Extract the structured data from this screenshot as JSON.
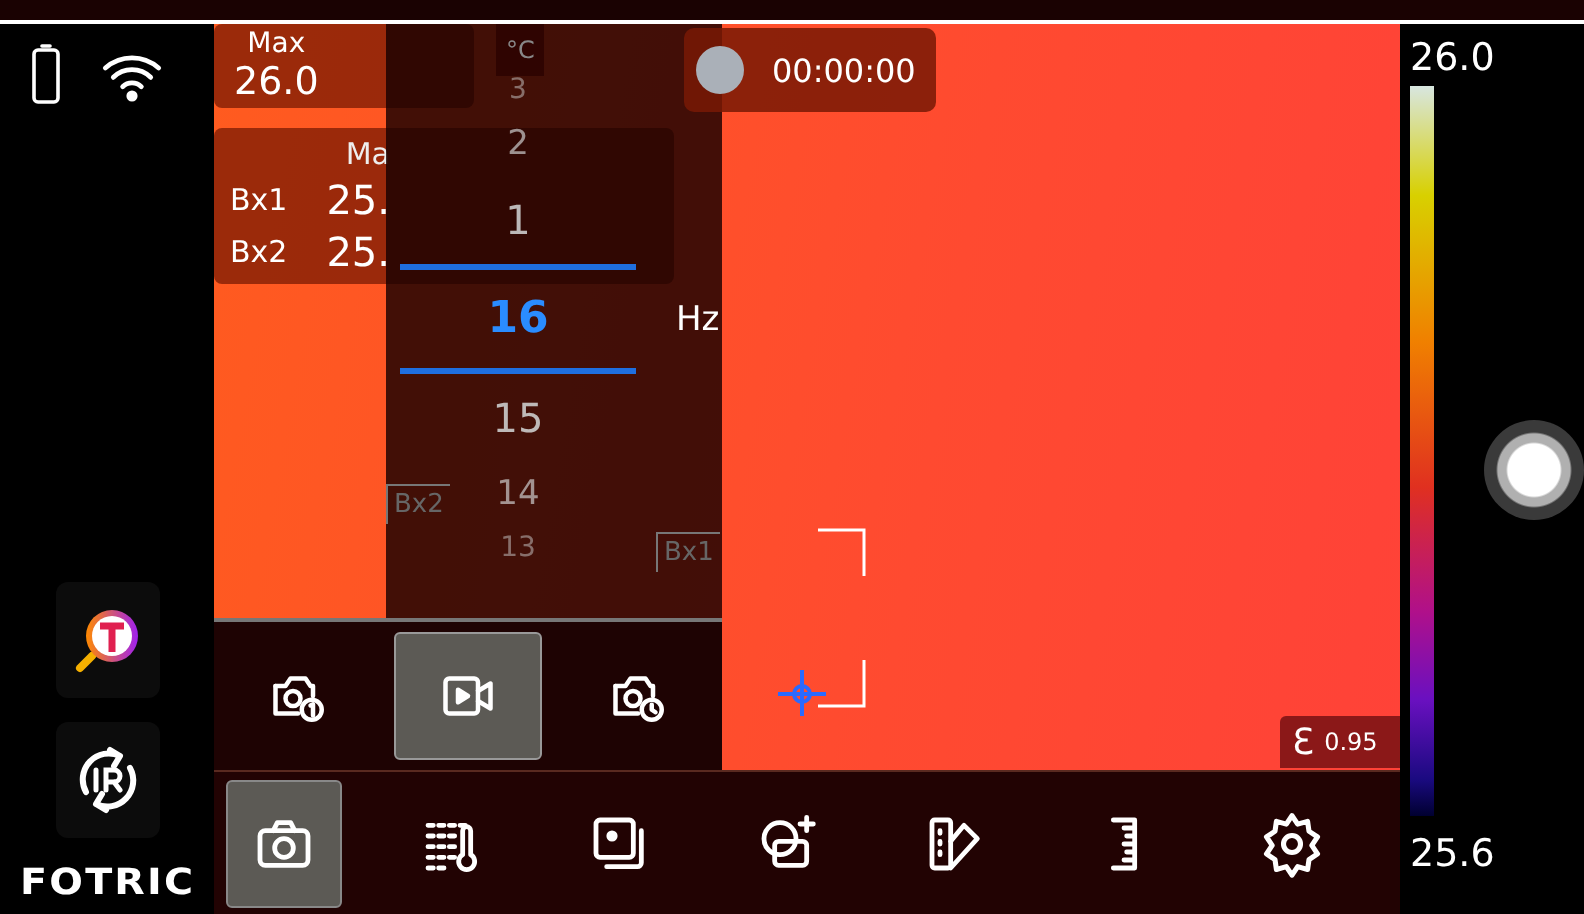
{
  "logo": "FOTRIC",
  "spot": {
    "label": "Max",
    "value": "26.0"
  },
  "temperature_unit": "°C",
  "box_table": {
    "columns": [
      "Ma"
    ],
    "rows": [
      {
        "name": "Bx1",
        "values": [
          "25."
        ]
      },
      {
        "name": "Bx2",
        "values": [
          "25."
        ]
      }
    ]
  },
  "recording": {
    "time": "00:00:00"
  },
  "frame_rate_picker": {
    "unit": "Hz",
    "options": [
      {
        "label": "3",
        "selected": false
      },
      {
        "label": "2",
        "selected": false
      },
      {
        "label": "1",
        "selected": false
      },
      {
        "label": "16",
        "selected": true
      },
      {
        "label": "15",
        "selected": false
      },
      {
        "label": "14",
        "selected": false
      },
      {
        "label": "13",
        "selected": false
      }
    ]
  },
  "box_labels": [
    "Bx2",
    "Bx1"
  ],
  "capture_modes": [
    {
      "kind": "single-photo",
      "selected": false
    },
    {
      "kind": "video",
      "selected": true
    },
    {
      "kind": "timed-photo",
      "selected": false
    }
  ],
  "emissivity": {
    "symbol": "Ɛ",
    "value": "0.95"
  },
  "toolbar": [
    {
      "kind": "camera",
      "selected": true
    },
    {
      "kind": "thermo-list",
      "selected": false
    },
    {
      "kind": "layers",
      "selected": false
    },
    {
      "kind": "shapes",
      "selected": false
    },
    {
      "kind": "palette",
      "selected": false
    },
    {
      "kind": "ruler",
      "selected": false
    },
    {
      "kind": "settings",
      "selected": false
    }
  ],
  "scale": {
    "max": "26.0",
    "min": "25.6"
  }
}
